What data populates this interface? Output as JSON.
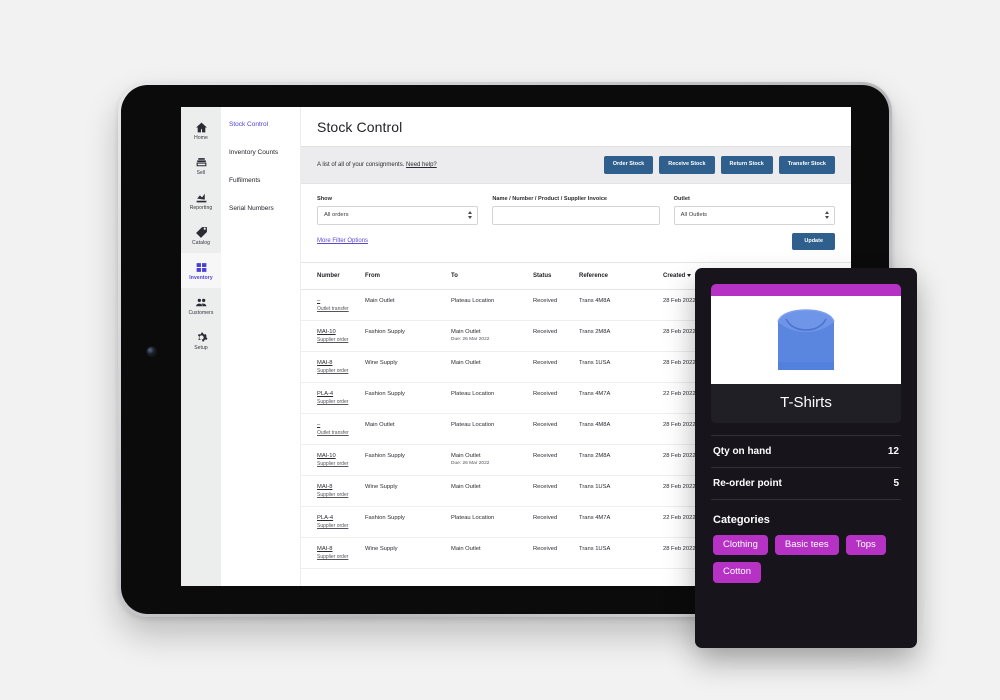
{
  "device": {
    "type": "tablet"
  },
  "rail": {
    "items": [
      {
        "label": "Home",
        "icon": "home-icon",
        "active": false
      },
      {
        "label": "Sell",
        "icon": "register-icon",
        "active": false
      },
      {
        "label": "Reporting",
        "icon": "bar-chart-icon",
        "active": false
      },
      {
        "label": "Catalog",
        "icon": "tag-icon",
        "active": false
      },
      {
        "label": "Inventory",
        "icon": "boxes-icon",
        "active": true
      },
      {
        "label": "Customers",
        "icon": "people-icon",
        "active": false
      },
      {
        "label": "Setup",
        "icon": "gear-icon",
        "active": false
      }
    ]
  },
  "subnav": {
    "items": [
      {
        "label": "Stock Control",
        "active": true
      },
      {
        "label": "Inventory Counts",
        "active": false
      },
      {
        "label": "Fulfilments",
        "active": false
      },
      {
        "label": "Serial Numbers",
        "active": false
      }
    ]
  },
  "page": {
    "title": "Stock Control",
    "description": "A list of all of your consignments.",
    "help_link": "Need help?",
    "actions": [
      {
        "label": "Order Stock"
      },
      {
        "label": "Receive Stock"
      },
      {
        "label": "Return Stock"
      },
      {
        "label": "Transfer Stock"
      }
    ]
  },
  "filters": {
    "show": {
      "label": "Show",
      "value": "All orders"
    },
    "search": {
      "label": "Name / Number / Product / Supplier Invoice",
      "value": "",
      "placeholder": ""
    },
    "outlet": {
      "label": "Outlet",
      "value": "All Outlets"
    },
    "more_options_link": "More Filter Options",
    "update_button": "Update"
  },
  "table": {
    "columns": [
      "Number",
      "From",
      "To",
      "Status",
      "Reference",
      "Created"
    ],
    "sorted_column": "Created",
    "rows": [
      {
        "number": "–",
        "number_type": "Outlet transfer",
        "from": "Main Outlet",
        "to": "Plateau Location",
        "to_due": "",
        "status": "Received",
        "reference": "Trans 4M8A",
        "created": "28 Feb 2022"
      },
      {
        "number": "MAI-10",
        "number_type": "Supplier order",
        "from": "Fashion Supply",
        "to": "Main Outlet",
        "to_due": "Due: 26 Mar 2022",
        "status": "Received",
        "reference": "Trans 2M8A",
        "created": "28 Feb 2022"
      },
      {
        "number": "MAI-8",
        "number_type": "Supplier order",
        "from": "Wine Supply",
        "to": "Main Outlet",
        "to_due": "",
        "status": "Received",
        "reference": "Trans 1USA",
        "created": "28 Feb 2022"
      },
      {
        "number": "PLA-4",
        "number_type": "Supplier order",
        "from": "Fashion Supply",
        "to": "Plateau Location",
        "to_due": "",
        "status": "Received",
        "reference": "Trans 4M7A",
        "created": "22 Feb 2022"
      },
      {
        "number": "–",
        "number_type": "Outlet transfer",
        "from": "Main Outlet",
        "to": "Plateau Location",
        "to_due": "",
        "status": "Received",
        "reference": "Trans 4M8A",
        "created": "28 Feb 2022"
      },
      {
        "number": "MAI-10",
        "number_type": "Supplier order",
        "from": "Fashion Supply",
        "to": "Main Outlet",
        "to_due": "Due: 26 Mar 2022",
        "status": "Received",
        "reference": "Trans 2M8A",
        "created": "28 Feb 2022"
      },
      {
        "number": "MAI-8",
        "number_type": "Supplier order",
        "from": "Wine Supply",
        "to": "Main Outlet",
        "to_due": "",
        "status": "Received",
        "reference": "Trans 1USA",
        "created": "28 Feb 2022"
      },
      {
        "number": "PLA-4",
        "number_type": "Supplier order",
        "from": "Fashion Supply",
        "to": "Plateau Location",
        "to_due": "",
        "status": "Received",
        "reference": "Trans 4M7A",
        "created": "22 Feb 2022"
      },
      {
        "number": "MAI-8",
        "number_type": "Supplier order",
        "from": "Wine Supply",
        "to": "Main Outlet",
        "to_due": "",
        "status": "Received",
        "reference": "Trans 1USA",
        "created": "28 Feb 2022"
      }
    ]
  },
  "product_panel": {
    "image_alt": "blue-folded-tshirt",
    "name": "T-Shirts",
    "stats": [
      {
        "label": "Qty on hand",
        "value": "12"
      },
      {
        "label": "Re-order point",
        "value": "5"
      }
    ],
    "categories_title": "Categories",
    "categories": [
      "Clothing",
      "Basic tees",
      "Tops",
      "Cotton"
    ]
  },
  "colors": {
    "accent_purple": "#4b3fd4",
    "link_purple": "#5a4ad1",
    "button_blue": "#2f5f8c",
    "magenta": "#b532c4",
    "panel_dark": "#17151b",
    "shirt_blue": "#5b86e0"
  }
}
